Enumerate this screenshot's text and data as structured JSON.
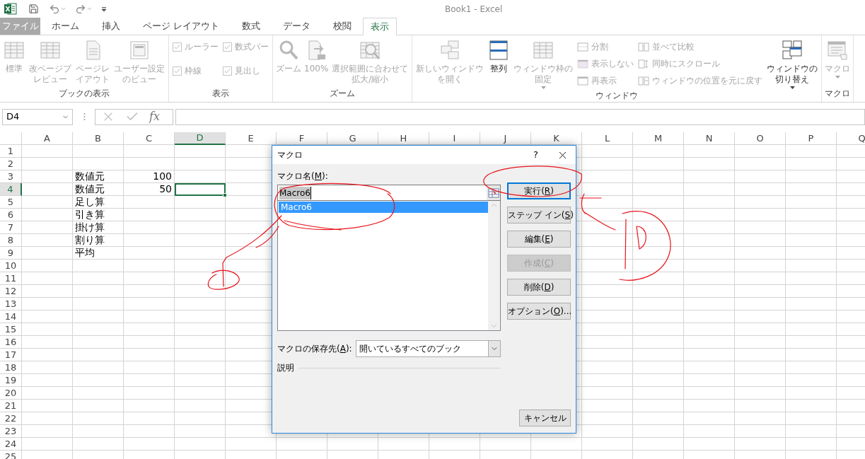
{
  "title_bar": {
    "title": "Book1 - Excel"
  },
  "tabs": [
    {
      "label": "ファイル",
      "kind": "file",
      "selected": false
    },
    {
      "label": "ホーム",
      "kind": "tab",
      "selected": false
    },
    {
      "label": "挿入",
      "kind": "tab",
      "selected": false
    },
    {
      "label": "ページ レイアウト",
      "kind": "tab",
      "selected": false
    },
    {
      "label": "数式",
      "kind": "tab",
      "selected": false
    },
    {
      "label": "データ",
      "kind": "tab",
      "selected": false
    },
    {
      "label": "校閲",
      "kind": "tab",
      "selected": false
    },
    {
      "label": "表示",
      "kind": "tab",
      "selected": true
    }
  ],
  "ribbon": {
    "groups": [
      {
        "label": "ブックの表示",
        "items": [
          {
            "kind": "large",
            "label": "標準",
            "disabled": true,
            "dropdown": false
          },
          {
            "kind": "large",
            "label": "改ページプレビュー",
            "disabled": true,
            "dropdown": false
          },
          {
            "kind": "large",
            "label": "ページレイアウト",
            "disabled": true,
            "dropdown": false
          },
          {
            "kind": "large",
            "label": "ユーザー設定のビュー",
            "disabled": true,
            "dropdown": false
          }
        ]
      },
      {
        "label": "表示",
        "items": [
          {
            "kind": "column",
            "items": [
              {
                "kind": "check",
                "label": "ルーラー",
                "checked": true,
                "disabled": true
              },
              {
                "kind": "check",
                "label": "枠線",
                "checked": true,
                "disabled": true
              }
            ]
          },
          {
            "kind": "column",
            "items": [
              {
                "kind": "check",
                "label": "数式バー",
                "checked": true,
                "disabled": true
              },
              {
                "kind": "check",
                "label": "見出し",
                "checked": true,
                "disabled": true
              }
            ]
          }
        ]
      },
      {
        "label": "ズーム",
        "items": [
          {
            "kind": "large",
            "label": "ズーム",
            "disabled": true,
            "dropdown": false
          },
          {
            "kind": "large",
            "label": "100%",
            "disabled": true,
            "dropdown": false
          },
          {
            "kind": "large",
            "label": "選択範囲に合わせて拡大/縮小",
            "disabled": true,
            "dropdown": false
          }
        ]
      },
      {
        "label": "ウィンドウ",
        "items": [
          {
            "kind": "large",
            "label": "新しいウィンドウを開く",
            "disabled": true,
            "dropdown": false
          },
          {
            "kind": "large",
            "label": "整列",
            "disabled": false,
            "dropdown": false
          },
          {
            "kind": "large",
            "label": "ウィンドウ枠の固定",
            "disabled": true,
            "dropdown": true
          },
          {
            "kind": "column",
            "items": [
              {
                "kind": "small",
                "label": "分割",
                "disabled": true
              },
              {
                "kind": "small",
                "label": "表示しない",
                "disabled": true
              },
              {
                "kind": "small",
                "label": "再表示",
                "disabled": true
              }
            ]
          },
          {
            "kind": "column",
            "items": [
              {
                "kind": "small",
                "label": "並べて比較",
                "disabled": true
              },
              {
                "kind": "small",
                "label": "同時にスクロール",
                "disabled": true
              },
              {
                "kind": "small",
                "label": "ウィンドウの位置を元に戻す",
                "disabled": true
              }
            ]
          },
          {
            "kind": "large",
            "label": "ウィンドウの切り替え",
            "disabled": false,
            "dropdown": true
          }
        ]
      },
      {
        "label": "マクロ",
        "items": [
          {
            "kind": "large",
            "label": "マクロ",
            "disabled": true,
            "dropdown": true
          }
        ]
      }
    ]
  },
  "formula_bar": {
    "name_box": "D4",
    "function_button": "fx"
  },
  "sheet": {
    "columns": [
      {
        "label": "A",
        "selected": false
      },
      {
        "label": "B",
        "selected": false
      },
      {
        "label": "C",
        "selected": false
      },
      {
        "label": "D",
        "selected": true
      },
      {
        "label": "E",
        "selected": false
      },
      {
        "label": "F",
        "selected": false
      },
      {
        "label": "G",
        "selected": false
      },
      {
        "label": "H",
        "selected": false
      },
      {
        "label": "I",
        "selected": false
      },
      {
        "label": "J",
        "selected": false
      },
      {
        "label": "K",
        "selected": false
      },
      {
        "label": "L",
        "selected": false
      },
      {
        "label": "M",
        "selected": false
      },
      {
        "label": "N",
        "selected": false
      },
      {
        "label": "O",
        "selected": false
      },
      {
        "label": "P",
        "selected": false
      },
      {
        "label": "Q",
        "selected": false
      }
    ],
    "rows": [
      {
        "label": "1",
        "selected": false
      },
      {
        "label": "2",
        "selected": false
      },
      {
        "label": "3",
        "selected": false,
        "column_b": "数値元",
        "column_c": "100"
      },
      {
        "label": "4",
        "selected": true,
        "column_b": "数値元",
        "column_c": "50"
      },
      {
        "label": "5",
        "selected": false,
        "column_b": "足し算"
      },
      {
        "label": "6",
        "selected": false,
        "column_b": "引き算"
      },
      {
        "label": "7",
        "selected": false,
        "column_b": "掛け算"
      },
      {
        "label": "8",
        "selected": false,
        "column_b": "割り算"
      },
      {
        "label": "9",
        "selected": false,
        "column_b": "平均"
      },
      {
        "label": "10",
        "selected": false
      },
      {
        "label": "11",
        "selected": false
      },
      {
        "label": "12",
        "selected": false
      },
      {
        "label": "13",
        "selected": false
      },
      {
        "label": "14",
        "selected": false
      },
      {
        "label": "15",
        "selected": false
      },
      {
        "label": "16",
        "selected": false
      },
      {
        "label": "17",
        "selected": false
      },
      {
        "label": "18",
        "selected": false
      },
      {
        "label": "19",
        "selected": false
      },
      {
        "label": "20",
        "selected": false
      },
      {
        "label": "21",
        "selected": false
      },
      {
        "label": "22",
        "selected": false
      },
      {
        "label": "23",
        "selected": false
      },
      {
        "label": "24",
        "selected": false
      },
      {
        "label": "25",
        "selected": false
      }
    ]
  },
  "dialog": {
    "title": "マクロ",
    "help": "?",
    "name_label": {
      "before": "マクロ名(",
      "key": "M",
      "after": "):"
    },
    "name_value": "Macro6",
    "macros": [
      {
        "label": "Macro6",
        "selected": true
      }
    ],
    "buttons": [
      {
        "before": "実行(",
        "key": "R",
        "after": ")",
        "default": true,
        "disabled": false
      },
      {
        "before": "ステップ イン(",
        "key": "S",
        "after": ")",
        "default": false,
        "disabled": false
      },
      {
        "before": "編集(",
        "key": "E",
        "after": ")",
        "default": false,
        "disabled": false
      },
      {
        "before": "作成(",
        "key": "C",
        "after": ")",
        "default": false,
        "disabled": true
      },
      {
        "before": "削除(",
        "key": "D",
        "after": ")",
        "default": false,
        "disabled": false
      },
      {
        "before": "オプション(",
        "key": "O",
        "after": ")...",
        "default": false,
        "disabled": false
      }
    ],
    "save_label": {
      "before": "マクロの保存先(",
      "key": "A",
      "after": "):"
    },
    "save_value": "開いているすべてのブック",
    "description_label": "説明",
    "cancel": {
      "before": "キャンセル"
    }
  }
}
